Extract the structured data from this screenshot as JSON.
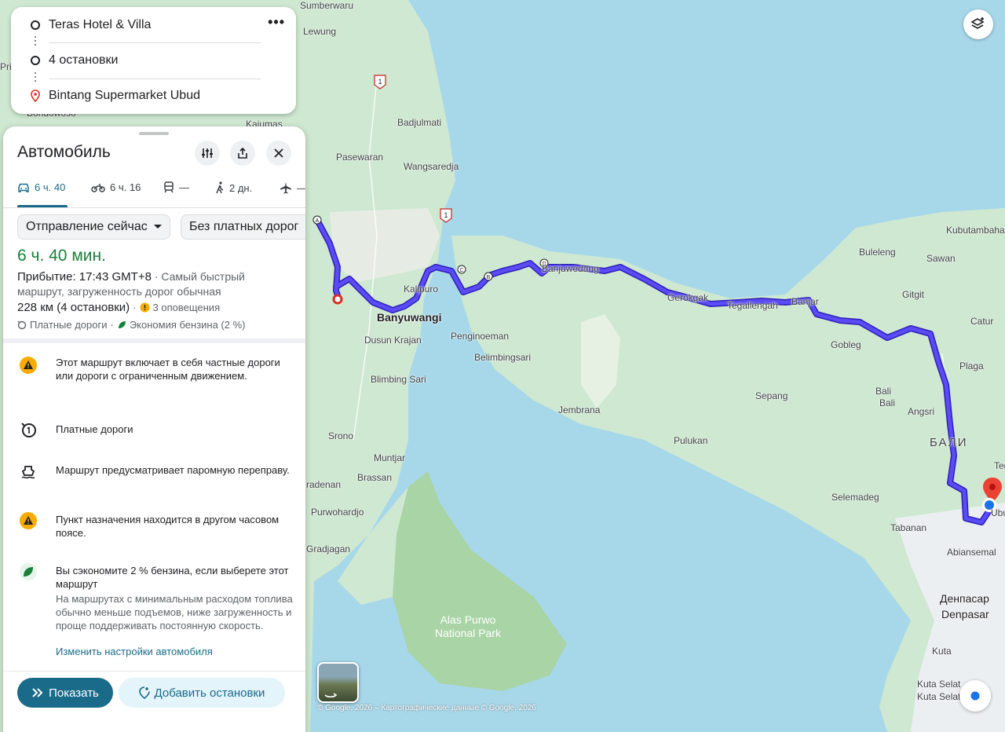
{
  "directions": {
    "origin": "Teras Hotel & Villa",
    "stops": "4 остановки",
    "destination": "Bintang Supermarket Ubud"
  },
  "panel": {
    "title": "Автомобиль",
    "modes": [
      {
        "icon": "car-icon",
        "label": "6 ч. 40"
      },
      {
        "icon": "motorcycle-icon",
        "label": "6 ч. 16"
      },
      {
        "icon": "train-icon",
        "label": "—"
      },
      {
        "icon": "walk-icon",
        "label": "2 дн."
      },
      {
        "icon": "plane-icon",
        "label": "—"
      }
    ],
    "depart_chip": "Отправление сейчас",
    "tolls_chip": "Без платных дорог",
    "duration": "6 ч. 40 мин.",
    "arrival": "Прибытие: 17:43 GMT+8",
    "arrival_rest": " · Самый быстрый маршрут, загруженность дорог обычная",
    "distance": "228 км (4 остановки)",
    "alerts": "3 оповещения",
    "features_tolls": "Платные дороги",
    "features_fuel": "Экономия бензина (2 %)",
    "notes": [
      {
        "icon": "warning-icon",
        "text": "Этот маршрут включает в себя частные дороги или дороги с ограниченным движением."
      },
      {
        "icon": "toll-icon",
        "text": "Платные дороги"
      },
      {
        "icon": "ferry-icon",
        "text": "Маршрут предусматривает паромную переправу."
      },
      {
        "icon": "warning-icon",
        "text": "Пункт назначения находится в другом часовом поясе."
      },
      {
        "icon": "leaf-icon",
        "text": "Вы сэкономите 2 % бензина, если выберете этот маршрут",
        "sub": "На маршрутах с минимальным расходом топлива обычно меньше подъемов, ниже загруженность и проще поддерживать постоянную скорость.",
        "link": "Изменить настройки автомобиля"
      }
    ],
    "show_button": "Показать",
    "add_stops_button": "Добавить остановки"
  },
  "map": {
    "labels": [
      "Sumberwaru",
      "Lewung",
      "Prin",
      "Bondowoso",
      "Kajumas",
      "Badjulmati",
      "Pasewaran",
      "Wangsaredja",
      "Kalipuro",
      "Banyuwangi",
      "Dusun Krajan",
      "Penginoeman",
      "Belimbingsari",
      "Blimbing Sari",
      "Srono",
      "Muntjar",
      "Brassan",
      "radenan",
      "Purwohardjo",
      "Gradjagan",
      "Alas Purwo National Park",
      "Banjuwedang",
      "Gerokgak",
      "Tegallengah",
      "Banjar",
      "Buleleng",
      "Sawan",
      "Kubutambahan",
      "Gitgit",
      "Catur",
      "Gobleg",
      "Plaga",
      "Bali",
      "Bali",
      "Angsri",
      "БАЛИ",
      "Sepang",
      "Jembrana",
      "Pulukan",
      "Selemadeg",
      "Tabanan",
      "Abiansemal",
      "Денпасар",
      "Denpasar",
      "Kuta",
      "Kuta Selat",
      "Kuta Selat",
      "Teg",
      "Ubud"
    ],
    "road_shields": [
      "1",
      "1"
    ],
    "stop_markers": [
      "A",
      "B",
      "C",
      "D"
    ],
    "copyright": "© Google, 2026 – Картографические данные © Google, 2026",
    "colors": {
      "route": "#4a3bf0",
      "route_outline": "#2f1fb8",
      "water": "#a7d8ea",
      "land": "#cfe8d1",
      "accent": "#1a6b8a",
      "duration": "#188038"
    }
  }
}
